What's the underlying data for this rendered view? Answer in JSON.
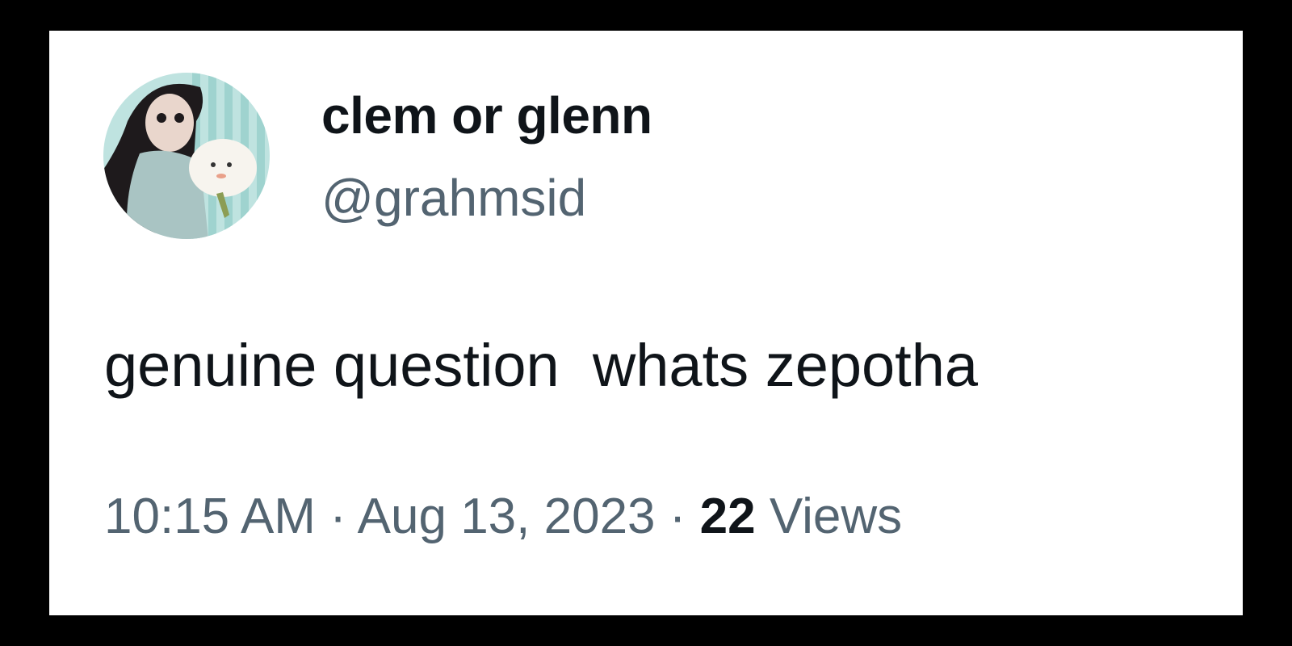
{
  "user": {
    "display_name": "clem or glenn",
    "handle": "@grahmsid"
  },
  "tweet": {
    "text": "genuine question  whats zepotha",
    "time": "10:15 AM",
    "separator": " · ",
    "date": "Aug 13, 2023",
    "views_count": "22",
    "views_label": "Views"
  },
  "icons": {
    "avatar": "profile-avatar"
  },
  "colors": {
    "background": "#000000",
    "card": "#ffffff",
    "primary_text": "#0f1419",
    "secondary_text": "#536471"
  }
}
